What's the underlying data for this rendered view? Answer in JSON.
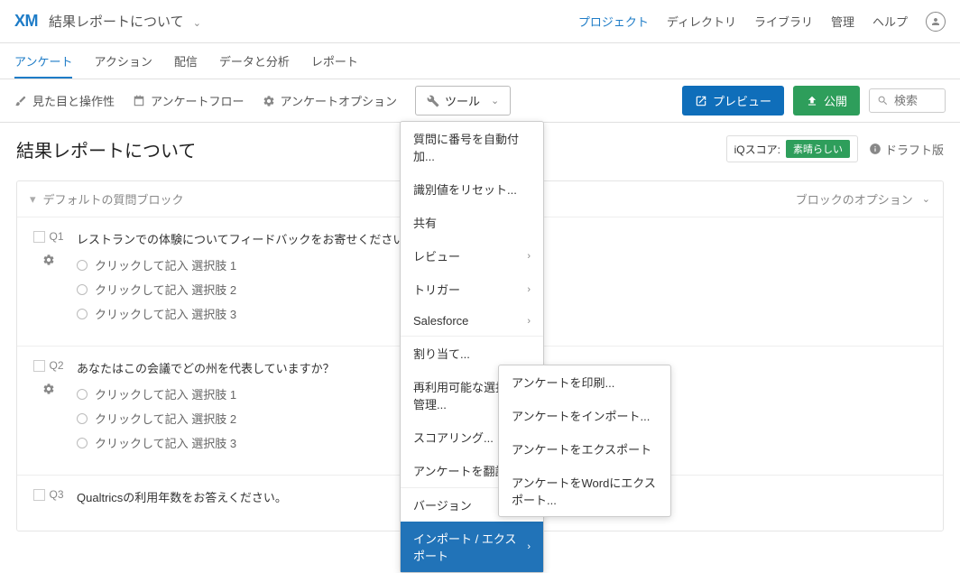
{
  "header": {
    "logo": "XM",
    "title": "結果レポートについて",
    "links": [
      "プロジェクト",
      "ディレクトリ",
      "ライブラリ",
      "管理",
      "ヘルプ"
    ],
    "active_link_index": 0
  },
  "tabs": {
    "items": [
      "アンケート",
      "アクション",
      "配信",
      "データと分析",
      "レポート"
    ],
    "active_index": 0
  },
  "toolbar": {
    "look_and_feel": "見た目と操作性",
    "flow": "アンケートフロー",
    "options": "アンケートオプション",
    "tools": "ツール",
    "preview": "プレビュー",
    "publish": "公開",
    "search_placeholder": "検索"
  },
  "tools_menu": {
    "group1": [
      "質問に番号を自動付加...",
      "識別値をリセット...",
      "共有",
      "レビュー",
      "トリガー",
      "Salesforce"
    ],
    "group1_arrow": [
      false,
      false,
      false,
      true,
      true,
      true
    ],
    "group2": [
      "割り当て...",
      "再利用可能な選択肢を管理...",
      "スコアリング...",
      "アンケートを翻訳..."
    ],
    "group3": [
      "バージョン",
      "インポート / エクスポート"
    ],
    "group3_arrow": [
      true,
      true
    ],
    "highlighted_index": 1
  },
  "submenu": {
    "items": [
      "アンケートを印刷...",
      "アンケートをインポート...",
      "アンケートをエクスポート",
      "アンケートをWordにエクスポート..."
    ]
  },
  "content": {
    "title": "結果レポートについて",
    "iq_label": "iQスコア:",
    "iq_value": "素晴らしい",
    "draft": "ドラフト版"
  },
  "block": {
    "title": "デフォルトの質問ブロック",
    "options_label": "ブロックのオプション"
  },
  "questions": [
    {
      "num": "Q1",
      "text": "レストランでの体験についてフィードバックをお寄せください！",
      "options": [
        "クリックして記入 選択肢 1",
        "クリックして記入 選択肢 2",
        "クリックして記入 選択肢 3"
      ]
    },
    {
      "num": "Q2",
      "text": "あなたはこの会議でどの州を代表していますか？",
      "options": [
        "クリックして記入 選択肢 1",
        "クリックして記入 選択肢 2",
        "クリックして記入 選択肢 3"
      ]
    },
    {
      "num": "Q3",
      "text": "Qualtricsの利用年数をお答えください。",
      "options": []
    }
  ]
}
